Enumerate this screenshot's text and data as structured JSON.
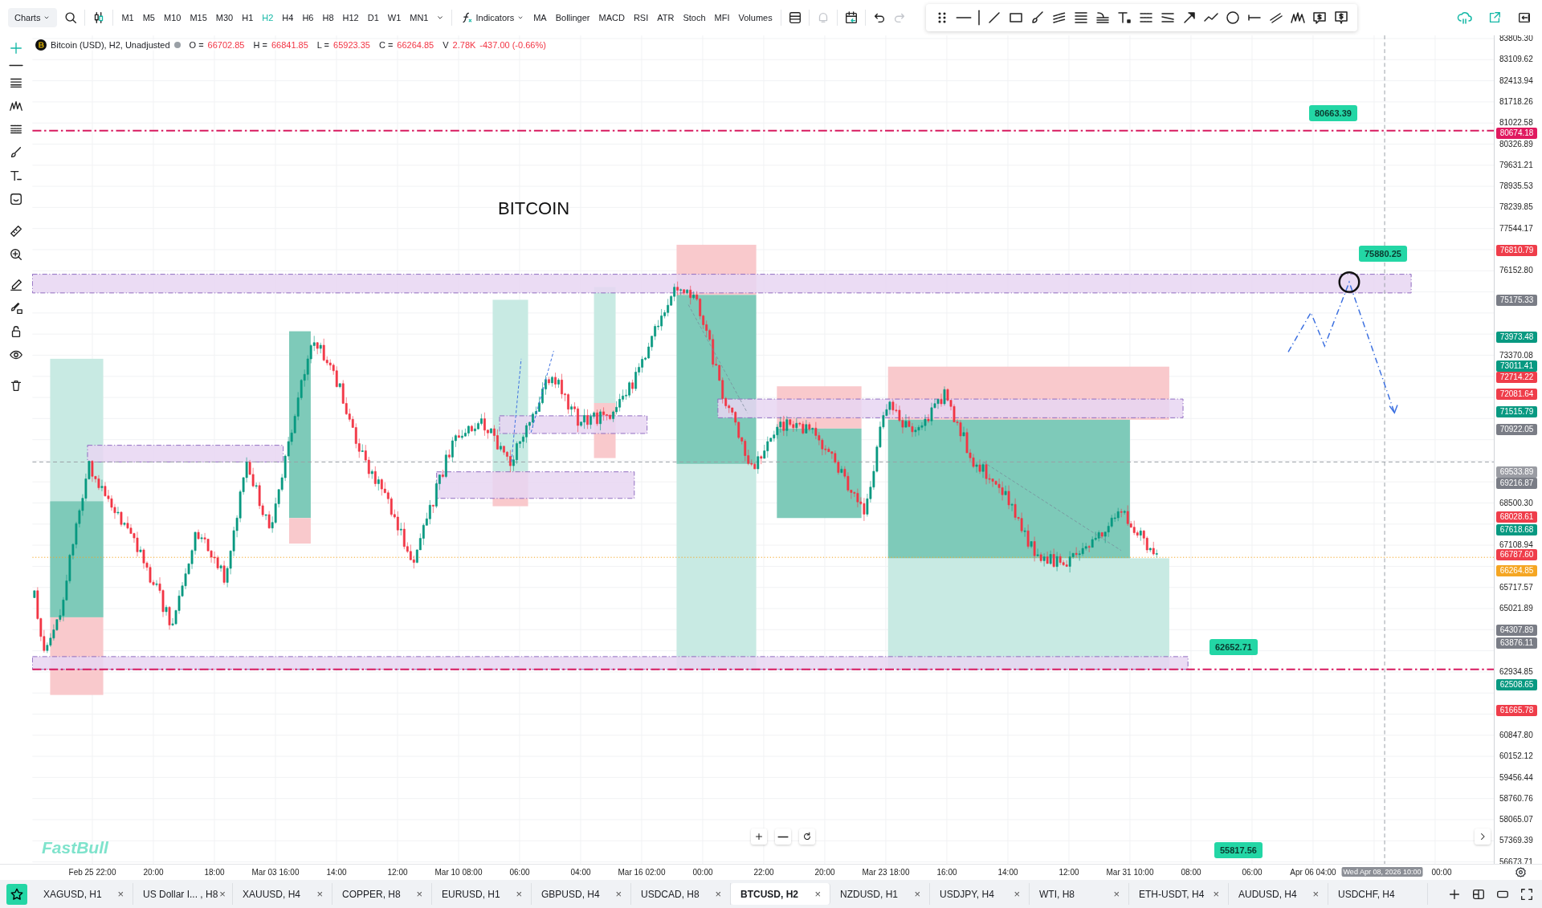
{
  "toolbar": {
    "chart_menu": "Charts",
    "timeframes": [
      {
        "label": "M1",
        "selected": false
      },
      {
        "label": "M5",
        "selected": false
      },
      {
        "label": "M10",
        "selected": false
      },
      {
        "label": "M15",
        "selected": false
      },
      {
        "label": "M30",
        "selected": false
      },
      {
        "label": "H1",
        "selected": false
      },
      {
        "label": "H2",
        "selected": true
      },
      {
        "label": "H4",
        "selected": false
      },
      {
        "label": "H6",
        "selected": false
      },
      {
        "label": "H8",
        "selected": false
      },
      {
        "label": "H12",
        "selected": false
      },
      {
        "label": "D1",
        "selected": false
      },
      {
        "label": "W1",
        "selected": false
      },
      {
        "label": "MN1",
        "selected": false
      }
    ],
    "indicators": "Indicators",
    "indicator_buttons": [
      "MA",
      "Bollinger",
      "MACD",
      "RSI",
      "ATR",
      "Stoch",
      "MFI",
      "Volumes"
    ]
  },
  "legend": {
    "symbol": "Bitcoin (USD), H2, Unadjusted",
    "values": [
      {
        "label": "O =",
        "value": "66702.85"
      },
      {
        "label": "H =",
        "value": "66841.85"
      },
      {
        "label": "L =",
        "value": "65923.35"
      },
      {
        "label": "C =",
        "value": "66264.85"
      },
      {
        "label": "V",
        "value": "2.78K"
      }
    ],
    "change": "-437.00 (-0.66%)"
  },
  "chart": {
    "title": "BITCOIN",
    "callouts": [
      "80663.39",
      "75880.25",
      "62652.71",
      "55817.56"
    ],
    "logo": "FastBull"
  },
  "price_axis": {
    "ticks": [
      "83805.30",
      "83109.62",
      "82413.94",
      "81718.26",
      "81022.58",
      "80326.89",
      "79631.21",
      "78935.53",
      "78239.85",
      "77544.17",
      "76152.80",
      "73370.08",
      "68500.30",
      "67108.94",
      "65717.57",
      "65021.89",
      "62934.85",
      "60847.80",
      "60152.12",
      "59456.44",
      "58760.76",
      "58065.07",
      "57369.39",
      "56673.71"
    ],
    "badges": [
      {
        "text": "80674.18",
        "color": "#e0195f"
      },
      {
        "text": "76810.79",
        "color": "#ef3d4a"
      },
      {
        "text": "75175.33",
        "color": "#7a7d86"
      },
      {
        "text": "73973.48",
        "color": "#089981"
      },
      {
        "text": "73011.41",
        "color": "#089981"
      },
      {
        "text": "72714.22",
        "color": "#ef3d4a"
      },
      {
        "text": "72081.64",
        "color": "#ef3d4a"
      },
      {
        "text": "71515.79",
        "color": "#089981"
      },
      {
        "text": "70922.05",
        "color": "#7a7d86"
      },
      {
        "text": "69533.89",
        "color": "#9a9ca3"
      },
      {
        "text": "69216.87",
        "color": "#7a7d86"
      },
      {
        "text": "68028.61",
        "color": "#ef3d4a"
      },
      {
        "text": "67618.68",
        "color": "#089981"
      },
      {
        "text": "66787.60",
        "color": "#ef3d4a"
      },
      {
        "text": "66264.85",
        "color": "#f5a623"
      },
      {
        "text": "64307.89",
        "color": "#7a7d86"
      },
      {
        "text": "63876.11",
        "color": "#7a7d86"
      },
      {
        "text": "62508.65",
        "color": "#089981"
      },
      {
        "text": "61665.78",
        "color": "#ef3d4a"
      }
    ]
  },
  "time_axis": {
    "labels": [
      {
        "text": "Feb 25 22:00"
      },
      {
        "text": "20:00"
      },
      {
        "text": "18:00"
      },
      {
        "text": "Mar 03 16:00"
      },
      {
        "text": "14:00"
      },
      {
        "text": "12:00"
      },
      {
        "text": "Mar 10 08:00"
      },
      {
        "text": "06:00"
      },
      {
        "text": "04:00"
      },
      {
        "text": "Mar 16 02:00"
      },
      {
        "text": "00:00"
      },
      {
        "text": "22:00"
      },
      {
        "text": "20:00"
      },
      {
        "text": "Mar 23 18:00"
      },
      {
        "text": "16:00"
      },
      {
        "text": "14:00"
      },
      {
        "text": "12:00"
      },
      {
        "text": "Mar 31 10:00"
      },
      {
        "text": "08:00"
      },
      {
        "text": "06:00"
      },
      {
        "text": "Apr 06 04:00"
      },
      {
        "text": "Wed Apr 08, 2026 10:00",
        "kind": "crosshair"
      },
      {
        "text": "00:00"
      }
    ]
  },
  "tabs": [
    {
      "label": "XAGUSD, H1",
      "selected": false,
      "close": "×"
    },
    {
      "label": "US Dollar I... , H8",
      "selected": false,
      "close": "×"
    },
    {
      "label": "XAUUSD, H4",
      "selected": false,
      "close": "×"
    },
    {
      "label": "COPPER, H8",
      "selected": false,
      "close": "×"
    },
    {
      "label": "EURUSD, H1",
      "selected": false,
      "close": "×"
    },
    {
      "label": "GBPUSD, H4",
      "selected": false,
      "close": "×"
    },
    {
      "label": "USDCAD, H8",
      "selected": false,
      "close": "×"
    },
    {
      "label": "BTCUSD, H2",
      "selected": true,
      "close": "×"
    },
    {
      "label": "NZDUSD, H1",
      "selected": false,
      "close": "×"
    },
    {
      "label": "USDJPY, H4",
      "selected": false,
      "close": "×"
    },
    {
      "label": "WTI, H8",
      "selected": false,
      "close": "×"
    },
    {
      "label": "ETH-USDT, H4",
      "selected": false,
      "close": "×"
    },
    {
      "label": "AUDUSD, H4",
      "selected": false,
      "close": "×"
    },
    {
      "label": "USDCHF, H4",
      "selected": false
    }
  ]
}
